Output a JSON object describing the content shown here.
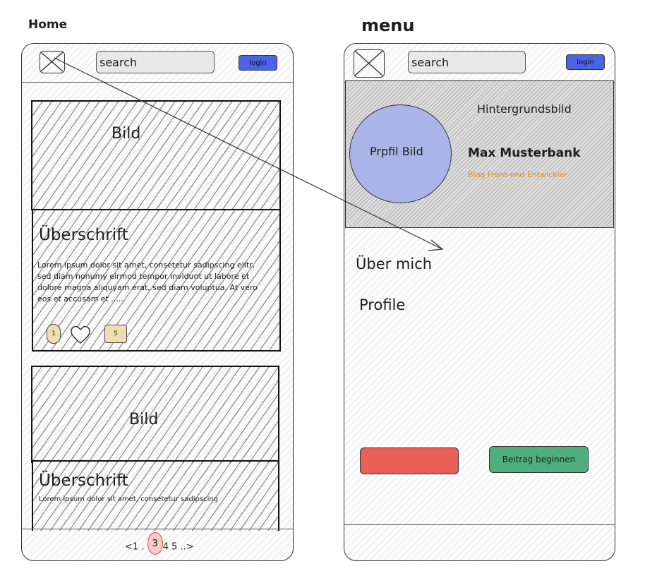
{
  "labels": {
    "home": "Home",
    "menu": "menu"
  },
  "home": {
    "search_placeholder": "search",
    "login_label": "login",
    "card1": {
      "image_label": "Bild",
      "heading": "Überschrift",
      "body": "Lorem ipsum dolor sit amet, consetetur sadipscing elitr, sed diam nonumy eirmod tempor invidunt ut labore et dolore magna aliquyam erat, sed diam voluptua. At vero eos et accusam et .....",
      "badge_count": "1",
      "comment_count": "5"
    },
    "card2": {
      "image_label": "Bild",
      "heading": "Überschrift",
      "body": "Lorem ipsum dolor sit amet, consetetur sadipscing"
    },
    "pagination": {
      "prev": "<",
      "p1": "1",
      "sep": ".",
      "current": "3",
      "p4": "4",
      "p5": "5",
      "ellipsis": "..",
      "next": ">"
    }
  },
  "menu": {
    "search_placeholder": "search",
    "login_label": "login",
    "background_label": "Hintergrundsbild",
    "profile_image_label": "Prpfil Bild",
    "name": "Max Musterbank",
    "subtitle": "Blog Front-end Entwickler",
    "items": [
      "Über mich",
      "Profile"
    ],
    "start_post_label": "Beitrag beginnen"
  },
  "colors": {
    "login": "#4a63e7",
    "profile_circle": "#a9b5e8",
    "subtitle": "#e8891a",
    "badge": "#f0deb0",
    "page_current": "#f5c9c6",
    "red_button": "#e86057",
    "green_button": "#4fae7e"
  }
}
